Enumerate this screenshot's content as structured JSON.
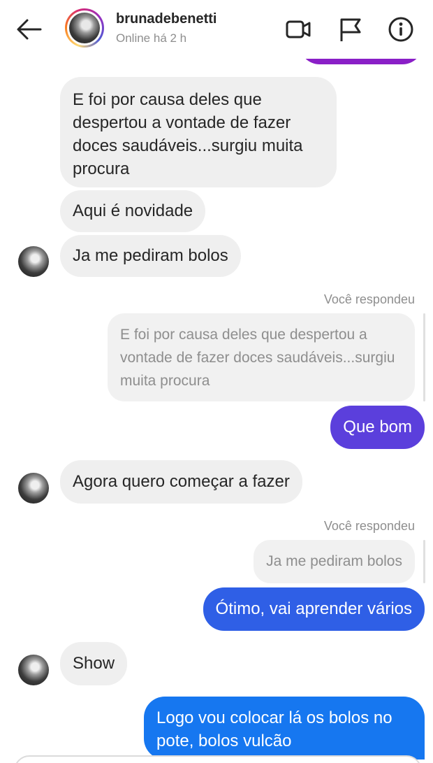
{
  "header": {
    "username": "brunadebenetti",
    "status": "Online há 2 h",
    "icons": [
      "back-arrow-icon",
      "video-call-icon",
      "flag-icon",
      "info-icon"
    ]
  },
  "messages": {
    "m1": "E foi por causa deles que despertou a vontade de fazer doces saudáveis...surgiu muita procura",
    "m2": "Aqui é novidade",
    "m3": "Ja me pediram bolos",
    "reply1_label": "Você respondeu",
    "reply1_quote": "E foi por causa deles que despertou a vontade de fazer doces saudáveis...surgiu muita procura",
    "m4": "Que bom",
    "m5": "Agora quero começar a fazer",
    "reply2_label": "Você respondeu",
    "reply2_quote": "Ja me pediram bolos",
    "m6": "Ótimo,  vai aprender vários",
    "m7": "Show",
    "m8": "Logo vou colocar lá os bolos no pote, bolos vulcão"
  },
  "colors": {
    "sent_purple_top": "#8a1fc7",
    "sent_violet": "#5b3fdc",
    "sent_blue_dark": "#2f5fe6",
    "sent_blue": "#1677f0",
    "received_bg": "#efefef"
  }
}
